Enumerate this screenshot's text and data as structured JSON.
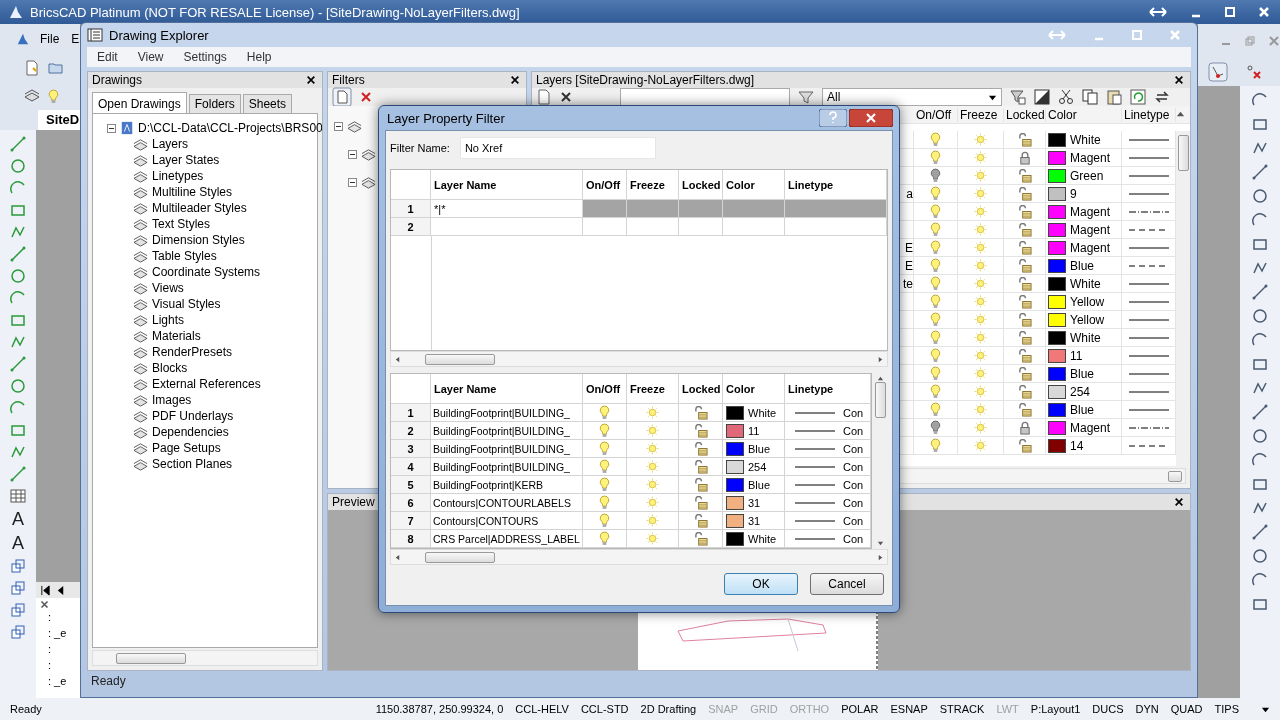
{
  "app": {
    "title": "BricsCAD Platinum (NOT FOR RESALE License) - [SiteDrawing-NoLayerFilters.dwg]",
    "menu": [
      "File",
      "E"
    ],
    "doc_tab": "SiteD",
    "tool_letters": [
      "A",
      "A"
    ],
    "command_lines": [
      ":",
      ": _e",
      ":",
      ":",
      ": _e"
    ],
    "status_bar": {
      "text": "Ready",
      "coords": "1150.38787, 250.99324, 0",
      "items": [
        {
          "label": "CCL-HELV",
          "kind": "label"
        },
        {
          "label": "CCL-STD",
          "kind": "label"
        },
        {
          "label": "2D Drafting",
          "kind": "label"
        },
        {
          "label": "SNAP",
          "kind": "toggle",
          "on": false
        },
        {
          "label": "GRID",
          "kind": "toggle",
          "on": false
        },
        {
          "label": "ORTHO",
          "kind": "toggle",
          "on": false
        },
        {
          "label": "POLAR",
          "kind": "toggle",
          "on": true
        },
        {
          "label": "ESNAP",
          "kind": "toggle",
          "on": true
        },
        {
          "label": "STRACK",
          "kind": "toggle",
          "on": true
        },
        {
          "label": "LWT",
          "kind": "toggle",
          "on": false
        },
        {
          "label": "P:Layout1",
          "kind": "toggle",
          "on": true
        },
        {
          "label": "DUCS",
          "kind": "toggle",
          "on": true
        },
        {
          "label": "DYN",
          "kind": "toggle",
          "on": true
        },
        {
          "label": "QUAD",
          "kind": "toggle",
          "on": true
        },
        {
          "label": "TIPS",
          "kind": "toggle",
          "on": true
        }
      ]
    }
  },
  "explorer": {
    "title": "Drawing Explorer",
    "menu": [
      "Edit",
      "View",
      "Settings",
      "Help"
    ],
    "drawings_panel": {
      "title": "Drawings",
      "tabs": [
        {
          "label": "Open Drawings",
          "selected": true
        },
        {
          "label": "Folders",
          "selected": false
        },
        {
          "label": "Sheets",
          "selected": false
        }
      ],
      "root": {
        "label": "D:\\CCL-Data\\CCL-Projects\\BRS00",
        "expanded": true,
        "children": [
          {
            "label": "Layers"
          },
          {
            "label": "Layer States"
          },
          {
            "label": "Linetypes"
          },
          {
            "label": "Multiline Styles"
          },
          {
            "label": "Multileader Styles"
          },
          {
            "label": "Text Styles"
          },
          {
            "label": "Dimension Styles"
          },
          {
            "label": "Table Styles"
          },
          {
            "label": "Coordinate Systems"
          },
          {
            "label": "Views"
          },
          {
            "label": "Visual Styles"
          },
          {
            "label": "Lights"
          },
          {
            "label": "Materials"
          },
          {
            "label": "RenderPresets"
          },
          {
            "label": "Blocks"
          },
          {
            "label": "External References"
          },
          {
            "label": "Images"
          },
          {
            "label": "PDF Underlays"
          },
          {
            "label": "Dependencies"
          },
          {
            "label": "Page Setups"
          },
          {
            "label": "Section Planes"
          }
        ]
      }
    },
    "filters_panel": {
      "title": "Filters"
    },
    "layers_panel": {
      "title": "Layers [SiteDrawing-NoLayerFilters.dwg]",
      "filter": "All",
      "columns": [
        "On/Off",
        "Freeze",
        "Locked",
        "Color",
        "Linetype"
      ],
      "rows": [
        {
          "on": true,
          "frozen": false,
          "locked": false,
          "color_name": "White",
          "color": "#000000",
          "kind": "solid"
        },
        {
          "on": true,
          "frozen": false,
          "locked": true,
          "color_name": "Magent",
          "color": "#ff00ff",
          "kind": "solid"
        },
        {
          "on": false,
          "frozen": false,
          "locked": false,
          "color_name": "Green",
          "color": "#00ff00",
          "kind": "solid"
        },
        {
          "name": "a",
          "on": true,
          "frozen": false,
          "locked": false,
          "color_name": "9",
          "color": "#c0c0c0",
          "kind": "solid"
        },
        {
          "on": true,
          "frozen": false,
          "locked": false,
          "color_name": "Magent",
          "color": "#ff00ff",
          "kind": "dashdot"
        },
        {
          "on": true,
          "frozen": false,
          "locked": false,
          "color_name": "Magent",
          "color": "#ff00ff",
          "kind": "dashed"
        },
        {
          "name": "E",
          "on": true,
          "frozen": false,
          "locked": false,
          "color_name": "Magent",
          "color": "#ff00ff",
          "kind": "solid"
        },
        {
          "name": "E",
          "on": true,
          "frozen": false,
          "locked": false,
          "color_name": "Blue",
          "color": "#0000ff",
          "kind": "dashed"
        },
        {
          "name": "te",
          "on": true,
          "frozen": false,
          "locked": false,
          "color_name": "White",
          "color": "#000000",
          "kind": "solid"
        },
        {
          "on": true,
          "frozen": false,
          "locked": false,
          "color_name": "Yellow",
          "color": "#ffff00",
          "kind": "solid"
        },
        {
          "on": true,
          "frozen": false,
          "locked": false,
          "color_name": "Yellow",
          "color": "#ffff00",
          "kind": "solid"
        },
        {
          "on": true,
          "frozen": false,
          "locked": false,
          "color_name": "White",
          "color": "#000000",
          "kind": "solid"
        },
        {
          "on": true,
          "frozen": false,
          "locked": false,
          "color_name": "11",
          "color": "#f07878",
          "kind": "solid"
        },
        {
          "on": true,
          "frozen": false,
          "locked": false,
          "color_name": "Blue",
          "color": "#0000ff",
          "kind": "solid"
        },
        {
          "on": true,
          "frozen": false,
          "locked": false,
          "color_name": "254",
          "color": "#d8d8d8",
          "kind": "solid"
        },
        {
          "on": true,
          "frozen": false,
          "locked": false,
          "color_name": "Blue",
          "color": "#0000ff",
          "kind": "solid"
        },
        {
          "on": false,
          "frozen": false,
          "locked": true,
          "color_name": "Magent",
          "color": "#ff00ff",
          "kind": "dashdot"
        },
        {
          "on": true,
          "frozen": false,
          "locked": false,
          "color_name": "14",
          "color": "#800000",
          "kind": "dashed"
        }
      ]
    },
    "preview_panel": {
      "title": "Preview"
    },
    "status": "Ready"
  },
  "dialog": {
    "title": "Layer Property Filter",
    "filter_name_label": "Filter Name:",
    "filter_name": "No Xref",
    "definition": {
      "columns": [
        "Layer Name",
        "On/Off",
        "Freeze",
        "Locked",
        "Color",
        "Linetype"
      ],
      "rows": [
        {
          "number": "1",
          "name": "*|*",
          "selected": true
        },
        {
          "number": "2",
          "selected": false
        }
      ]
    },
    "preview": {
      "columns": [
        "Layer Name",
        "On/Off",
        "Freeze",
        "Locked",
        "Color",
        "Linetype"
      ],
      "rows": [
        {
          "number": "1",
          "name": "BuildingFootprint|BUILDING_",
          "on": true,
          "frozen": false,
          "locked": false,
          "color_name": "White",
          "color": "#000000",
          "linetype": "Con"
        },
        {
          "number": "2",
          "name": "BuildingFootprint|BUILDING_",
          "on": true,
          "frozen": false,
          "locked": false,
          "color_name": "11",
          "color": "#e06878",
          "linetype": "Con"
        },
        {
          "number": "3",
          "name": "BuildingFootprint|BUILDING_",
          "on": true,
          "frozen": false,
          "locked": false,
          "color_name": "Blue",
          "color": "#0000ff",
          "linetype": "Con"
        },
        {
          "number": "4",
          "name": "BuildingFootprint|BUILDING_",
          "on": true,
          "frozen": false,
          "locked": false,
          "color_name": "254",
          "color": "#d8d8d8",
          "linetype": "Con"
        },
        {
          "number": "5",
          "name": "BuildingFootprint|KERB",
          "on": true,
          "frozen": false,
          "locked": false,
          "color_name": "Blue",
          "color": "#0000ff",
          "linetype": "Con"
        },
        {
          "number": "6",
          "name": "Contours|CONTOURLABELS",
          "on": true,
          "frozen": false,
          "locked": false,
          "color_name": "31",
          "color": "#f0b080",
          "linetype": "Con"
        },
        {
          "number": "7",
          "name": "Contours|CONTOURS",
          "on": true,
          "frozen": false,
          "locked": false,
          "color_name": "31",
          "color": "#f0b080",
          "linetype": "Con"
        },
        {
          "number": "8",
          "name": "CRS Parcel|ADDRESS_LABEL",
          "on": true,
          "frozen": false,
          "locked": false,
          "color_name": "White",
          "color": "#000000",
          "linetype": "Con"
        }
      ]
    },
    "buttons": [
      {
        "label": "OK",
        "default": true
      },
      {
        "label": "Cancel",
        "default": false
      }
    ]
  }
}
